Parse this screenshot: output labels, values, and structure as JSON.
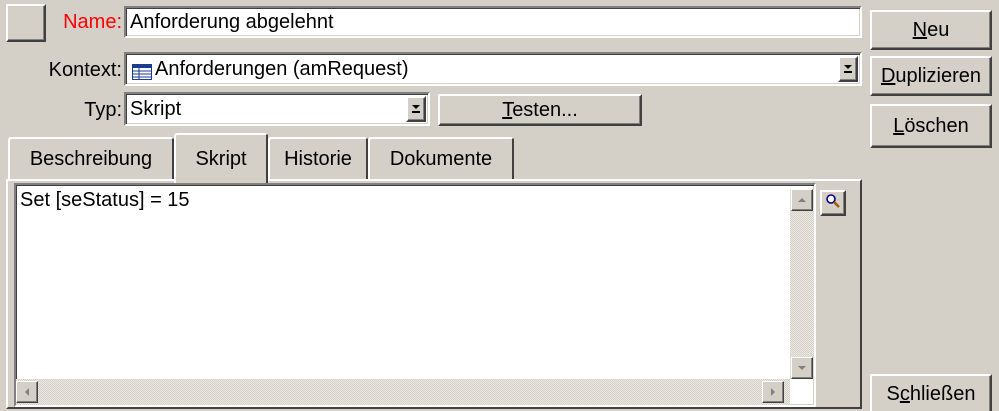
{
  "form": {
    "name_label": "Name:",
    "name_value": "Anforderung abgelehnt",
    "context_label": "Kontext:",
    "context_value": "Anforderungen (amRequest)",
    "type_label": "Typ:",
    "type_value": "Skript",
    "test_button": {
      "hotkey": "T",
      "rest": "esten..."
    }
  },
  "tabs": [
    {
      "label": "Beschreibung",
      "active": false
    },
    {
      "label": "Skript",
      "active": true
    },
    {
      "label": "Historie",
      "active": false
    },
    {
      "label": "Dokumente",
      "active": false
    }
  ],
  "script": {
    "code": "Set [seStatus] = 15"
  },
  "sidebar": {
    "new": {
      "hotkey": "N",
      "rest": "eu"
    },
    "duplicate": {
      "hotkey": "D",
      "rest": "uplizieren"
    },
    "delete": {
      "hotkey": "L",
      "rest": "öschen"
    },
    "close": {
      "pre": "S",
      "hotkey": "c",
      "rest": "hließen"
    }
  },
  "colors": {
    "background": "#d4d0c8",
    "name_label": "#ff0000"
  }
}
